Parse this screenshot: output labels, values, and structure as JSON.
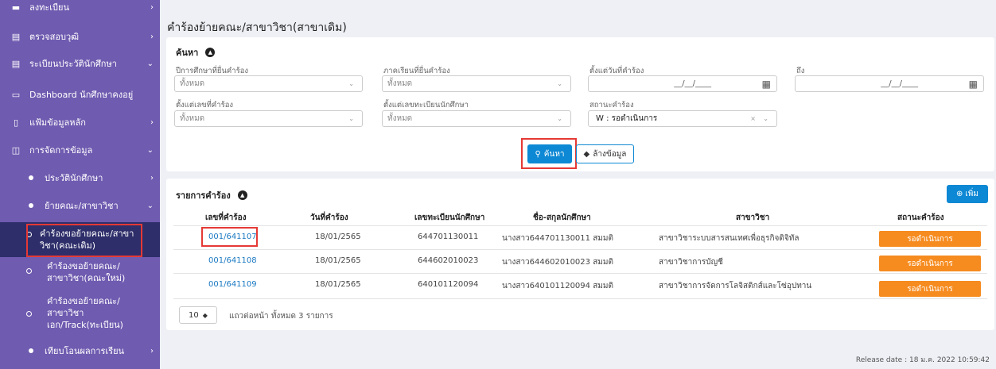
{
  "sidebar": {
    "items": [
      {
        "label": "ลงทะเบียน"
      },
      {
        "label": "ตรวจสอบวุฒิ"
      },
      {
        "label": "ระเบียนประวัตินักศึกษา"
      },
      {
        "label": "Dashboard นักศึกษาคงอยู่"
      },
      {
        "label": "แฟ้มข้อมูลหลัก"
      },
      {
        "label": "การจัดการข้อมูล"
      },
      {
        "label": "ประวัตินักศึกษา"
      },
      {
        "label": "ย้ายคณะ/สาขาวิชา"
      },
      {
        "label": "คำร้องขอย้ายคณะ/สาขาวิชา(คณะเดิม)"
      },
      {
        "label": "คำร้องขอย้ายคณะ/สาขาวิชา(คณะใหม่)"
      },
      {
        "label": "คำร้องขอย้ายคณะ/สาขาวิชาเอก/Track(ทะเบียน)"
      },
      {
        "label": "เทียบโอนผลการเรียน"
      }
    ]
  },
  "page": {
    "title": "คำร้องย้ายคณะ/สาขาวิชา(สาขาเดิม)"
  },
  "search": {
    "heading": "ค้นหา",
    "fields": [
      {
        "label": "ปีการศึกษาที่ยื่นคำร้อง",
        "value": "ทั้งหมด"
      },
      {
        "label": "ภาคเรียนที่ยื่นคำร้อง",
        "value": "ทั้งหมด"
      },
      {
        "label": "ตั้งแต่วันที่คำร้อง",
        "value": "__/__/____"
      },
      {
        "label": "ถึง",
        "value": "__/__/____"
      },
      {
        "label": "ตั้งแต่เลขที่คำร้อง",
        "value": "ทั้งหมด"
      },
      {
        "label": "ตั้งแต่เลขทะเบียนนักศึกษา",
        "value": "ทั้งหมด"
      },
      {
        "label": "สถานะคำร้อง",
        "value": "W : รอดำเนินการ"
      }
    ],
    "search_button": "ค้นหา",
    "clear_button": "ล้างข้อมูล"
  },
  "list": {
    "heading": "รายการคำร้อง",
    "add_button": "เพิ่ม",
    "columns": [
      "เลขที่คำร้อง",
      "วันที่คำร้อง",
      "เลขทะเบียนนักศึกษา",
      "ชื่อ-สกุลนักศึกษา",
      "สาขาวิชา",
      "สถานะคำร้อง"
    ],
    "rows": [
      {
        "no": "001/641107",
        "date": "18/01/2565",
        "sid": "644701130011",
        "name": "นางสาว644701130011 สมมติ",
        "major": "สาขาวิชาระบบสารสนเทศเพื่อธุรกิจดิจิทัล",
        "status": "รอดำเนินการ"
      },
      {
        "no": "001/641108",
        "date": "18/01/2565",
        "sid": "644602010023",
        "name": "นางสาว644602010023 สมมติ",
        "major": "สาขาวิชาการบัญชี",
        "status": "รอดำเนินการ"
      },
      {
        "no": "001/641109",
        "date": "18/01/2565",
        "sid": "640101120094",
        "name": "นางสาว640101120094 สมมติ",
        "major": "สาขาวิชาการจัดการโลจิสติกส์และโซ่อุปทาน",
        "status": "รอดำเนินการ"
      }
    ],
    "page_size": "10",
    "page_info": "แถวต่อหน้า ทั้งหมด 3 รายการ"
  },
  "footer": {
    "release": "Release date : 18 ม.ค. 2022 10:59:42"
  },
  "colors": {
    "sidebar": "#6f5bb0",
    "sidebar_active": "#2e2e6a",
    "primary": "#0d88d4",
    "status": "#f68b1f",
    "highlight": "#e53935"
  }
}
